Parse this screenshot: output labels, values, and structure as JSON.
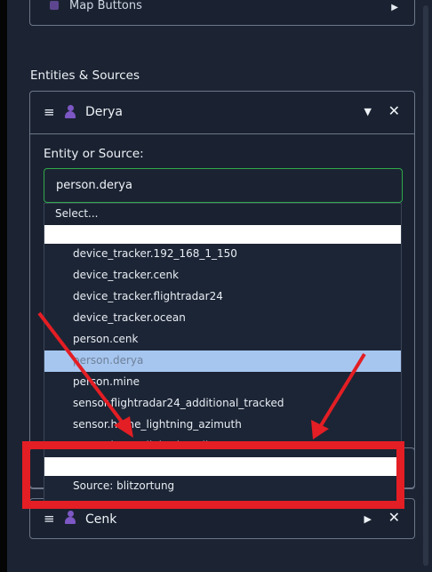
{
  "top_card": {
    "title": "Map Buttons",
    "arrow": "▶"
  },
  "section": {
    "title": "Entities & Sources"
  },
  "entity_card": {
    "name": "Derya",
    "caret": "▼",
    "close": "✕",
    "menu_icon": "≡",
    "field_label": "Entity or Source:",
    "selected_value": "person.derya"
  },
  "dropdown": {
    "placeholder": "Select...",
    "items": [
      "device_tracker.192_168_1_150",
      "device_tracker.cenk",
      "device_tracker.flightradar24",
      "device_tracker.ocean",
      "person.cenk",
      "person.derya",
      "person.mine",
      "sensor.flightradar24_additional_tracked",
      "sensor.home_lightning_azimuth",
      "sensor.home_lightning_distance"
    ],
    "selected_item": "person.derya",
    "source_item": "Source: blitzortung"
  },
  "bottom_card": {
    "name": "Cenk",
    "arrow": "▶",
    "close": "✕",
    "menu_icon": "≡"
  },
  "colors": {
    "accent_red": "#e31e24",
    "focus_green": "#2eaa4a",
    "selected_bg": "#a6c6ef",
    "avatar_purple": "#7d57c4"
  }
}
